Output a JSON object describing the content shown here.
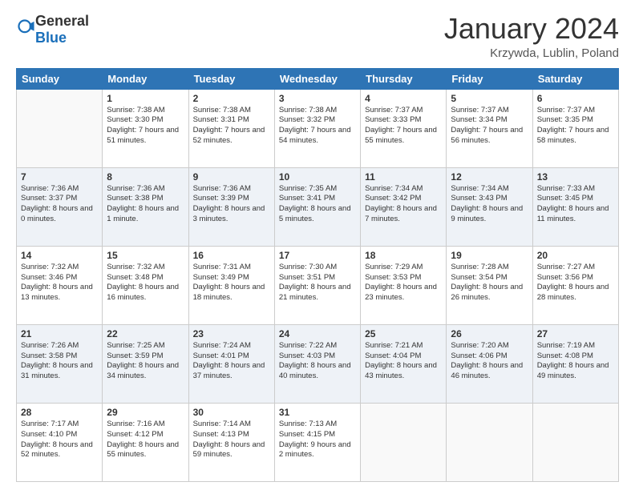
{
  "header": {
    "logo": {
      "general": "General",
      "blue": "Blue"
    },
    "title": "January 2024",
    "location": "Krzywda, Lublin, Poland"
  },
  "weekdays": [
    "Sunday",
    "Monday",
    "Tuesday",
    "Wednesday",
    "Thursday",
    "Friday",
    "Saturday"
  ],
  "weeks": [
    [
      {
        "day": null
      },
      {
        "day": 1,
        "sunrise": "7:38 AM",
        "sunset": "3:30 PM",
        "daylight": "7 hours and 51 minutes."
      },
      {
        "day": 2,
        "sunrise": "7:38 AM",
        "sunset": "3:31 PM",
        "daylight": "7 hours and 52 minutes."
      },
      {
        "day": 3,
        "sunrise": "7:38 AM",
        "sunset": "3:32 PM",
        "daylight": "7 hours and 54 minutes."
      },
      {
        "day": 4,
        "sunrise": "7:37 AM",
        "sunset": "3:33 PM",
        "daylight": "7 hours and 55 minutes."
      },
      {
        "day": 5,
        "sunrise": "7:37 AM",
        "sunset": "3:34 PM",
        "daylight": "7 hours and 56 minutes."
      },
      {
        "day": 6,
        "sunrise": "7:37 AM",
        "sunset": "3:35 PM",
        "daylight": "7 hours and 58 minutes."
      }
    ],
    [
      {
        "day": 7,
        "sunrise": "7:36 AM",
        "sunset": "3:37 PM",
        "daylight": "8 hours and 0 minutes."
      },
      {
        "day": 8,
        "sunrise": "7:36 AM",
        "sunset": "3:38 PM",
        "daylight": "8 hours and 1 minute."
      },
      {
        "day": 9,
        "sunrise": "7:36 AM",
        "sunset": "3:39 PM",
        "daylight": "8 hours and 3 minutes."
      },
      {
        "day": 10,
        "sunrise": "7:35 AM",
        "sunset": "3:41 PM",
        "daylight": "8 hours and 5 minutes."
      },
      {
        "day": 11,
        "sunrise": "7:34 AM",
        "sunset": "3:42 PM",
        "daylight": "8 hours and 7 minutes."
      },
      {
        "day": 12,
        "sunrise": "7:34 AM",
        "sunset": "3:43 PM",
        "daylight": "8 hours and 9 minutes."
      },
      {
        "day": 13,
        "sunrise": "7:33 AM",
        "sunset": "3:45 PM",
        "daylight": "8 hours and 11 minutes."
      }
    ],
    [
      {
        "day": 14,
        "sunrise": "7:32 AM",
        "sunset": "3:46 PM",
        "daylight": "8 hours and 13 minutes."
      },
      {
        "day": 15,
        "sunrise": "7:32 AM",
        "sunset": "3:48 PM",
        "daylight": "8 hours and 16 minutes."
      },
      {
        "day": 16,
        "sunrise": "7:31 AM",
        "sunset": "3:49 PM",
        "daylight": "8 hours and 18 minutes."
      },
      {
        "day": 17,
        "sunrise": "7:30 AM",
        "sunset": "3:51 PM",
        "daylight": "8 hours and 21 minutes."
      },
      {
        "day": 18,
        "sunrise": "7:29 AM",
        "sunset": "3:53 PM",
        "daylight": "8 hours and 23 minutes."
      },
      {
        "day": 19,
        "sunrise": "7:28 AM",
        "sunset": "3:54 PM",
        "daylight": "8 hours and 26 minutes."
      },
      {
        "day": 20,
        "sunrise": "7:27 AM",
        "sunset": "3:56 PM",
        "daylight": "8 hours and 28 minutes."
      }
    ],
    [
      {
        "day": 21,
        "sunrise": "7:26 AM",
        "sunset": "3:58 PM",
        "daylight": "8 hours and 31 minutes."
      },
      {
        "day": 22,
        "sunrise": "7:25 AM",
        "sunset": "3:59 PM",
        "daylight": "8 hours and 34 minutes."
      },
      {
        "day": 23,
        "sunrise": "7:24 AM",
        "sunset": "4:01 PM",
        "daylight": "8 hours and 37 minutes."
      },
      {
        "day": 24,
        "sunrise": "7:22 AM",
        "sunset": "4:03 PM",
        "daylight": "8 hours and 40 minutes."
      },
      {
        "day": 25,
        "sunrise": "7:21 AM",
        "sunset": "4:04 PM",
        "daylight": "8 hours and 43 minutes."
      },
      {
        "day": 26,
        "sunrise": "7:20 AM",
        "sunset": "4:06 PM",
        "daylight": "8 hours and 46 minutes."
      },
      {
        "day": 27,
        "sunrise": "7:19 AM",
        "sunset": "4:08 PM",
        "daylight": "8 hours and 49 minutes."
      }
    ],
    [
      {
        "day": 28,
        "sunrise": "7:17 AM",
        "sunset": "4:10 PM",
        "daylight": "8 hours and 52 minutes."
      },
      {
        "day": 29,
        "sunrise": "7:16 AM",
        "sunset": "4:12 PM",
        "daylight": "8 hours and 55 minutes."
      },
      {
        "day": 30,
        "sunrise": "7:14 AM",
        "sunset": "4:13 PM",
        "daylight": "8 hours and 59 minutes."
      },
      {
        "day": 31,
        "sunrise": "7:13 AM",
        "sunset": "4:15 PM",
        "daylight": "9 hours and 2 minutes."
      },
      {
        "day": null
      },
      {
        "day": null
      },
      {
        "day": null
      }
    ]
  ]
}
